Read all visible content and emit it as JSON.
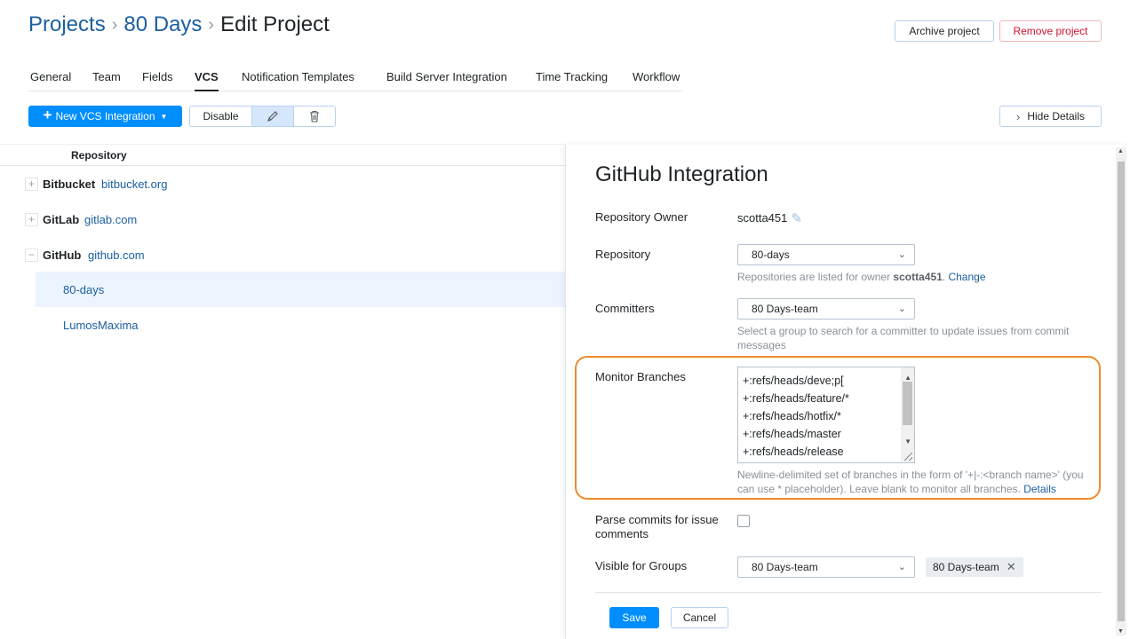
{
  "breadcrumb": {
    "projects": "Projects",
    "project": "80 Days",
    "current": "Edit Project",
    "separator": "›"
  },
  "header_actions": {
    "archive": "Archive project",
    "remove": "Remove project"
  },
  "tabs": [
    {
      "label": "General",
      "active": false
    },
    {
      "label": "Team",
      "active": false
    },
    {
      "label": "Fields",
      "active": false
    },
    {
      "label": "VCS",
      "active": true
    },
    {
      "label": "Notification Templates",
      "active": false
    },
    {
      "label": "Build Server Integration",
      "active": false
    },
    {
      "label": "Time Tracking",
      "active": false
    },
    {
      "label": "Workflow",
      "active": false
    }
  ],
  "toolbar": {
    "new_vcs": "New VCS Integration",
    "disable": "Disable",
    "hide_details": "Hide Details"
  },
  "tree": {
    "header": "Repository",
    "servers": [
      {
        "name": "Bitbucket",
        "url": "bitbucket.org",
        "toggle": "+"
      },
      {
        "name": "GitLab",
        "url": "gitlab.com",
        "toggle": "+"
      },
      {
        "name": "GitHub",
        "url": "github.com",
        "toggle": "−"
      }
    ],
    "repos": [
      {
        "name": "80-days",
        "selected": true
      },
      {
        "name": "LumosMaxima",
        "selected": false
      }
    ]
  },
  "panel": {
    "title": "GitHub Integration",
    "owner_label": "Repository Owner",
    "owner_value": "scotta451",
    "repository_label": "Repository",
    "repository_value": "80-days",
    "repository_hint_prefix": "Repositories are listed for owner ",
    "repository_hint_owner": "scotta451",
    "repository_hint_suffix": ". ",
    "repository_hint_link": "Change",
    "committers_label": "Committers",
    "committers_value": "80 Days-team",
    "committers_hint": "Select a group to search for a committer to update issues from commit messages",
    "monitor_label": "Monitor Branches",
    "monitor_lines": [
      "+:refs/heads/deve;p[",
      "+:refs/heads/feature/*",
      "+:refs/heads/hotfix/*",
      "+:refs/heads/master",
      "+:refs/heads/release"
    ],
    "monitor_hint": "Newline-delimited set of branches in the form of '+|-:<branch name>' (you can use * placeholder). Leave blank to monitor all branches. ",
    "monitor_hint_link": "Details",
    "parse_label": "Parse commits for issue comments",
    "parse_checked": false,
    "visible_label": "Visible for Groups",
    "visible_value": "80 Days-team",
    "visible_tag": "80 Days-team",
    "save": "Save",
    "cancel": "Cancel"
  },
  "colors": {
    "accent": "#008eff",
    "link": "#1b5fa1",
    "danger": "#d2122e",
    "highlight": "#f08a2c"
  }
}
